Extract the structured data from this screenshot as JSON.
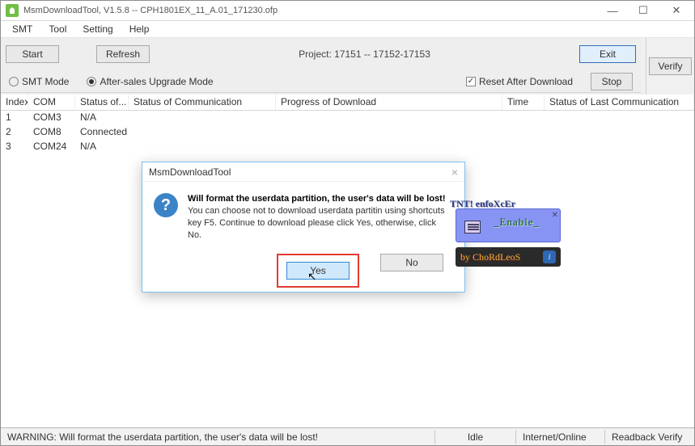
{
  "window": {
    "title": "MsmDownloadTool, V1.5.8 -- CPH1801EX_11_A.01_171230.ofp"
  },
  "menubar": [
    "SMT",
    "Tool",
    "Setting",
    "Help"
  ],
  "toolbar": {
    "start": "Start",
    "refresh": "Refresh",
    "project": "Project: 17151 -- 17152-17153",
    "exit": "Exit",
    "verify": "Verify"
  },
  "mode": {
    "smt": "SMT Mode",
    "after_sales": "After-sales Upgrade Mode",
    "reset_after_download": "Reset After Download",
    "stop": "Stop"
  },
  "columns": {
    "index": "Index",
    "com": "COM",
    "status_of": "Status of...",
    "status_comm": "Status of Communication",
    "progress": "Progress of Download",
    "time": "Time",
    "last": "Status of Last Communication"
  },
  "rows": [
    {
      "index": "1",
      "com": "COM3",
      "status": "N/A"
    },
    {
      "index": "2",
      "com": "COM8",
      "status": "Connected"
    },
    {
      "index": "3",
      "com": "COM24",
      "status": "N/A"
    }
  ],
  "dialog": {
    "title": "MsmDownloadTool",
    "msg_strong": "Will format the userdata partition, the user's data will be lost!",
    "msg_rest": " You can choose not to download userdata partitin using shortcuts key F5. Continue to download please click Yes, otherwise, click No.",
    "yes": "Yes",
    "no": "No"
  },
  "statusbar": {
    "warn": "WARNING: Will format the userdata partition, the user's data will be lost!",
    "idle": "Idle",
    "internet": "Internet/Online",
    "readback": "Readback Verify"
  },
  "watermark": {
    "brand": "TNT! enfoXcEr",
    "enable": "_Enable_",
    "by": "by ChoRdLeoS"
  }
}
